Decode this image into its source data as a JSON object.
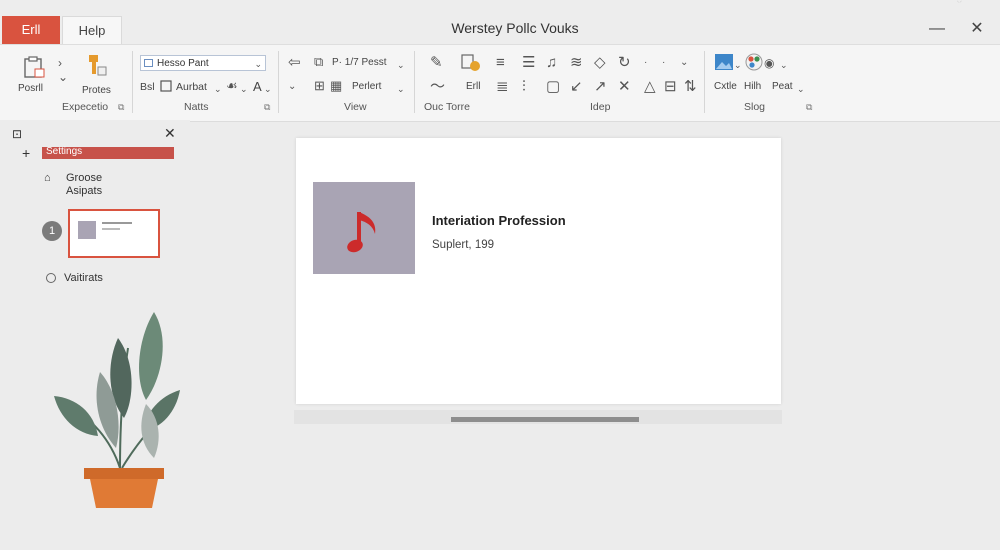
{
  "window": {
    "title": "Werstey Pollc Vouks",
    "tabs": [
      {
        "label": "Erll",
        "active": true
      },
      {
        "label": "Help",
        "active": false
      }
    ],
    "controls": {
      "minimize": "—",
      "close": "✕"
    }
  },
  "ribbon": {
    "groups": [
      {
        "label": "Expecetio",
        "items": [
          {
            "icon": "clipboard-icon",
            "label": "Posrll"
          },
          {
            "icon": "format-painter-icon",
            "label": "Protes"
          }
        ]
      },
      {
        "label": "Natts",
        "font_name": "Hesso Pant",
        "items": [
          {
            "label": "Bsl"
          },
          {
            "icon": "image-icon",
            "label": "Aurbat"
          },
          {
            "label": "A"
          }
        ]
      },
      {
        "label": "View",
        "items": [
          {
            "label": "P· 1/7 Pesst"
          },
          {
            "label": "Perlert"
          }
        ]
      },
      {
        "label": "Ouc Torre",
        "items": [
          {
            "label": "Erll"
          }
        ]
      },
      {
        "label": "Idep",
        "items": []
      },
      {
        "label": "Slog",
        "items": [
          {
            "icon": "picture-icon",
            "label": "Cxtle"
          },
          {
            "icon": "color-palette-icon",
            "label": "Hilh"
          },
          {
            "label": "Peat"
          }
        ]
      }
    ]
  },
  "left_pane": {
    "active_item": "Settings",
    "items": [
      {
        "label": "Groose"
      },
      {
        "label": "Asipats"
      },
      {
        "label": "Vaitirats"
      }
    ],
    "slide_number": "1"
  },
  "slide": {
    "title": "Interiation Profession",
    "subtitle": "Suplert, 199"
  }
}
